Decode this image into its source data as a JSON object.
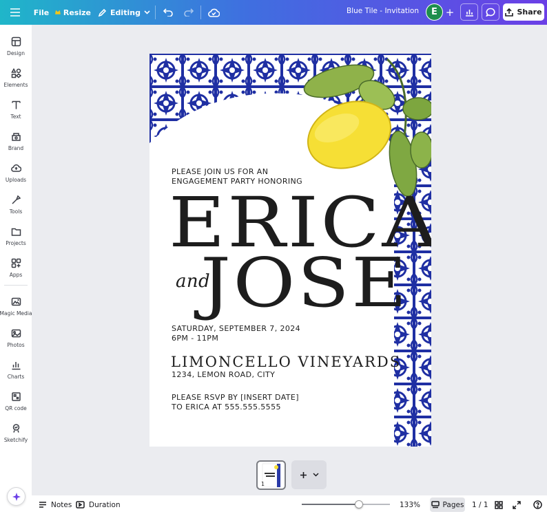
{
  "topbar": {
    "file_label": "File",
    "resize_label": "Resize",
    "editing_label": "Editing",
    "doc_title": "Blue Tile - Invitation",
    "avatar_initial": "E",
    "add_people": "+",
    "share_label": "Share"
  },
  "sidebar": {
    "items": [
      {
        "label": "Design",
        "icon": "design-icon"
      },
      {
        "label": "Elements",
        "icon": "elements-icon"
      },
      {
        "label": "Text",
        "icon": "text-icon"
      },
      {
        "label": "Brand",
        "icon": "brand-icon"
      },
      {
        "label": "Uploads",
        "icon": "uploads-icon"
      },
      {
        "label": "Tools",
        "icon": "tools-icon"
      },
      {
        "label": "Projects",
        "icon": "projects-icon"
      },
      {
        "label": "Apps",
        "icon": "apps-icon"
      },
      {
        "label": "Magic Media",
        "icon": "magic-media-icon"
      },
      {
        "label": "Photos",
        "icon": "photos-icon"
      },
      {
        "label": "Charts",
        "icon": "charts-icon"
      },
      {
        "label": "QR code",
        "icon": "qr-code-icon"
      },
      {
        "label": "Sketchify",
        "icon": "sketchify-icon"
      }
    ]
  },
  "invitation": {
    "line1": "PLEASE JOIN US FOR AN",
    "line2": "ENGAGEMENT PARTY HONORING",
    "name1": "ERICA",
    "and_word": "and",
    "name2": "JOSE",
    "date_line": "SATURDAY, SEPTEMBER 7, 2024",
    "time_line": "6PM - 11PM",
    "venue": "LIMONCELLO VINEYARDS",
    "address": "1234, LEMON ROAD,  CITY",
    "rsvp1": "PLEASE RSVP BY [INSERT DATE]",
    "rsvp2": "TO ERICA AT 555.555.5555",
    "tile_color": "#1f2fa3"
  },
  "footer": {
    "page_thumb_number": "1",
    "notes_label": "Notes",
    "duration_label": "Duration",
    "zoom_level": "133%",
    "zoom_fraction": 0.65,
    "pages_label": "Pages",
    "page_count": "1 / 1"
  }
}
